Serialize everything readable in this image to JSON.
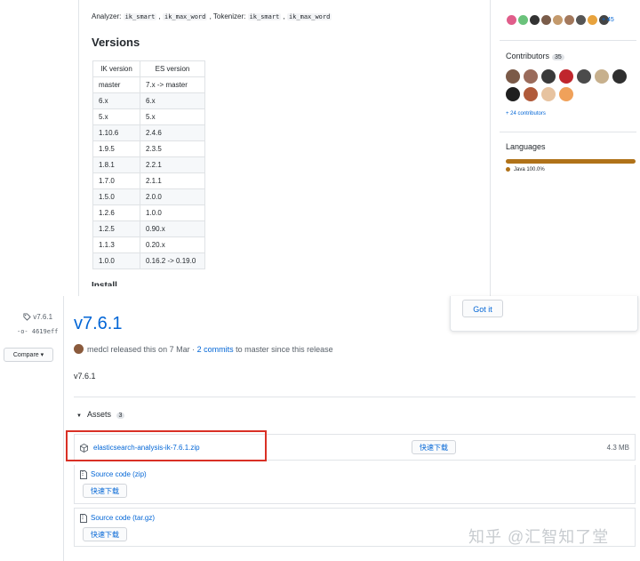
{
  "readme": {
    "analyzer_label": "Analyzer:",
    "analyzers": [
      "ik_smart",
      "ik_max_word"
    ],
    "tokenizer_label": "Tokenizer:",
    "tokenizers": [
      "ik_smart",
      "ik_max_word"
    ],
    "versions_title": "Versions",
    "table_headers": [
      "IK version",
      "ES version"
    ],
    "table_rows": [
      [
        "master",
        "7.x -> master"
      ],
      [
        "6.x",
        "6.x"
      ],
      [
        "5.x",
        "5.x"
      ],
      [
        "1.10.6",
        "2.4.6"
      ],
      [
        "1.9.5",
        "2.3.5"
      ],
      [
        "1.8.1",
        "2.2.1"
      ],
      [
        "1.7.0",
        "2.1.1"
      ],
      [
        "1.5.0",
        "2.0.0"
      ],
      [
        "1.2.6",
        "1.0.0"
      ],
      [
        "1.2.5",
        "0.90.x"
      ],
      [
        "1.1.3",
        "0.20.x"
      ],
      [
        "1.0.0",
        "0.16.2 -> 0.19.0"
      ]
    ],
    "next_heading": "Install"
  },
  "sidebar": {
    "plus_more": "+ 45",
    "contributors_title": "Contributors",
    "contributors_count": "35",
    "more_contributors": "+ 24 contributors",
    "languages_title": "Languages",
    "language": "Java 100.0%"
  },
  "release": {
    "tag": "v7.6.1",
    "commit": "4619eff",
    "compare_label": "Compare ▾",
    "title": "v7.6.1",
    "author": "medcl",
    "released_text": "released this on 7 Mar ·",
    "commits_link": "2 commits",
    "since_text": "to master since this release",
    "body": "v7.6.1",
    "assets_label": "Assets",
    "assets_count": "3",
    "got_it": "Got it",
    "assets": [
      {
        "name": "elasticsearch-analysis-ik-7.6.1.zip",
        "download": "快速下载",
        "size": "4.3 MB"
      },
      {
        "name": "Source code (zip)",
        "download": "快速下载"
      },
      {
        "name": "Source code (tar.gz)",
        "download": "快速下载"
      }
    ]
  },
  "watermark": "知乎 @汇智知了堂",
  "colors": {
    "link": "#0366d6",
    "java": "#b07219",
    "highlight": "#d93025"
  }
}
